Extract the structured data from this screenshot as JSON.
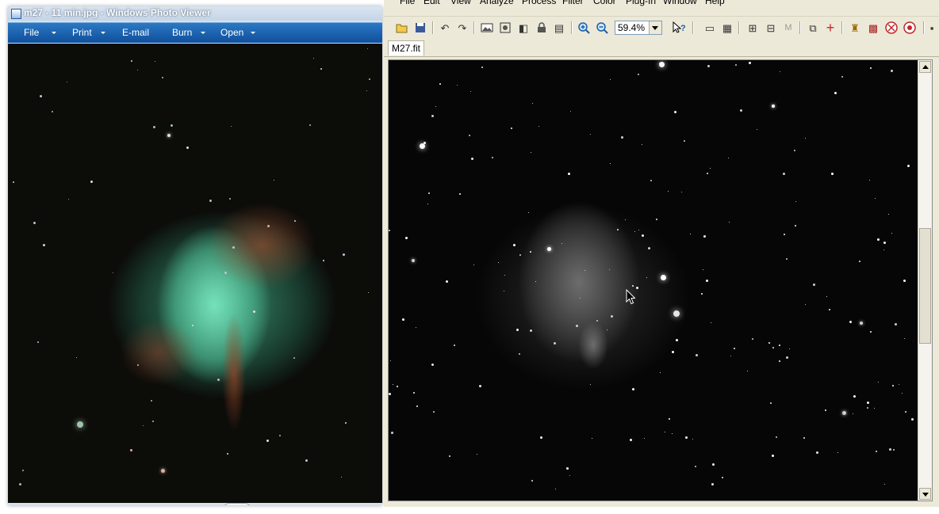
{
  "photo_viewer": {
    "title": "m27 - 11 min.jpg - Windows Photo Viewer",
    "menu": [
      "File",
      "Print",
      "E-mail",
      "Burn",
      "Open"
    ]
  },
  "app": {
    "menu": [
      "File",
      "Edit",
      "View",
      "Analyze",
      "Process",
      "Filter",
      "Color",
      "Plug-In",
      "Window",
      "Help"
    ],
    "zoom_value": "59.4%",
    "tab_label": "M27.fit",
    "toolbar_icons": [
      "open-folder-icon",
      "save-icon",
      "undo-icon",
      "redo-icon",
      "image-icon",
      "fit-window-icon",
      "flip-icon",
      "lock-icon",
      "properties-icon",
      "zoom-in-icon",
      "zoom-out-icon",
      "help-cursor-icon",
      "measure-icon",
      "stack-icon",
      "cross-hair-icon",
      "align-icon",
      "marker-icon",
      "copy-icon",
      "plus-icon",
      "brush-icon",
      "grid-icon",
      "stop-icon",
      "record-icon"
    ]
  }
}
